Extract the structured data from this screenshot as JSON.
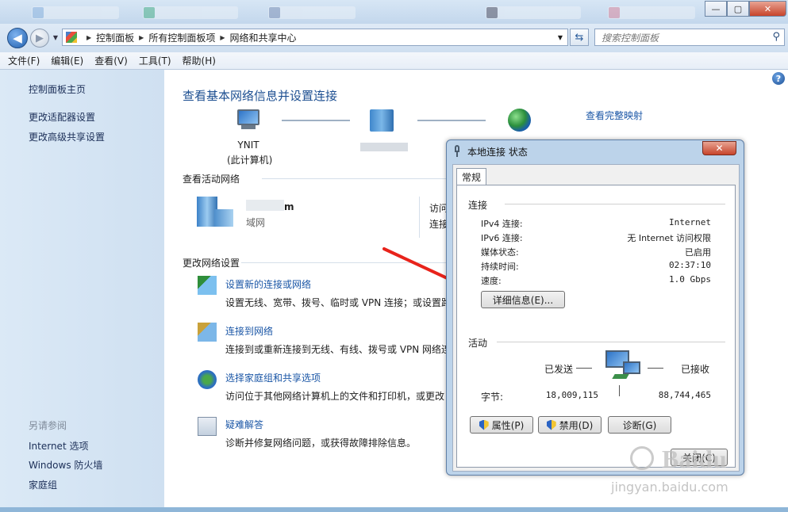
{
  "window": {
    "controls": {
      "minimize": "—",
      "maximize": "▢",
      "close": "✕"
    }
  },
  "address": {
    "crumbs": [
      "控制面板",
      "所有控制面板项",
      "网络和共享中心"
    ],
    "search_placeholder": "搜索控制面板"
  },
  "menu": [
    "文件(F)",
    "编辑(E)",
    "查看(V)",
    "工具(T)",
    "帮助(H)"
  ],
  "sidebar": {
    "home": "控制面板主页",
    "links": [
      "更改适配器设置",
      "更改高级共享设置"
    ],
    "see_also_title": "另请参阅",
    "see_also": [
      "Internet 选项",
      "Windows 防火墙",
      "家庭组"
    ]
  },
  "main": {
    "title": "查看基本网络信息并设置连接",
    "full_map_link": "查看完整映射",
    "computer_name": "YNIT",
    "computer_sub": "(此计算机)",
    "active_networks_title": "查看活动网络",
    "network_name": "m",
    "network_type": "域网",
    "access_label": "访问",
    "connect_label": "连接",
    "change_settings_title": "更改网络设置",
    "settings": [
      {
        "link": "设置新的连接或网络",
        "desc": "设置无线、宽带、拨号、临时或 VPN 连接；或设置路"
      },
      {
        "link": "连接到网络",
        "desc": "连接到或重新连接到无线、有线、拨号或 VPN 网络连"
      },
      {
        "link": "选择家庭组和共享选项",
        "desc": "访问位于其他网络计算机上的文件和打印机，或更改"
      },
      {
        "link": "疑难解答",
        "desc": "诊断并修复网络问题，或获得故障排除信息。"
      }
    ]
  },
  "dialog": {
    "title": "本地连接 状态",
    "tab": "常规",
    "connection_group": "连接",
    "rows": [
      {
        "label": "IPv4 连接:",
        "value": "Internet"
      },
      {
        "label": "IPv6 连接:",
        "value": "无 Internet 访问权限"
      },
      {
        "label": "媒体状态:",
        "value": "已启用"
      },
      {
        "label": "持续时间:",
        "value": "02:37:10"
      },
      {
        "label": "速度:",
        "value": "1.0 Gbps"
      }
    ],
    "details_button": "详细信息(E)...",
    "activity_group": "活动",
    "sent_label": "已发送",
    "received_label": "已接收",
    "bytes_label": "字节:",
    "bytes_sent": "18,009,115",
    "bytes_received": "88,744,465",
    "properties_button": "属性(P)",
    "disable_button": "禁用(D)",
    "diagnose_button": "诊断(G)",
    "close_button": "关闭(C)"
  },
  "watermark": {
    "brand": "Baidu",
    "url": "jingyan.baidu.com"
  },
  "colors": {
    "accent_link": "#1a56a6",
    "title_blue": "#1d4f91",
    "arrow_red": "#e8231b"
  }
}
